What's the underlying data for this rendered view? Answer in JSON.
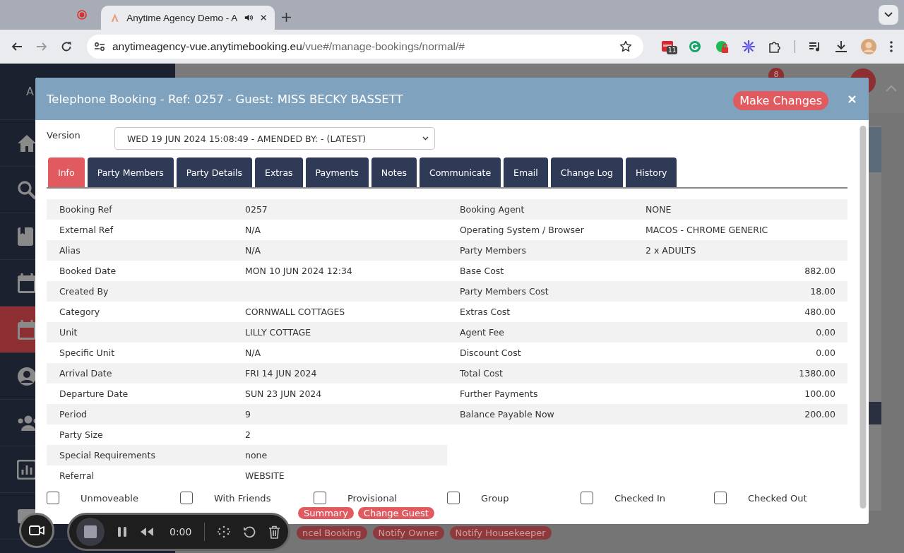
{
  "browser": {
    "tabs": [
      {
        "kind": "recording",
        "selected": false
      },
      {
        "kind": "page",
        "title": "Anytime Agency Demo - A",
        "selected": true
      }
    ],
    "address": {
      "host": "anytimeagency-vue.anytimebooking.eu",
      "path": "/vue#/manage-bookings/normal/#"
    },
    "extension_badge": "11"
  },
  "app": {
    "brand": "A",
    "sidebar": [
      {
        "kind": "home",
        "selected": false
      },
      {
        "kind": "search",
        "selected": false
      },
      {
        "kind": "book",
        "selected": false
      },
      {
        "kind": "calendar",
        "selected": false
      },
      {
        "kind": "calendar",
        "selected": true
      },
      {
        "kind": "user",
        "selected": false
      },
      {
        "kind": "users",
        "selected": false
      },
      {
        "kind": "chart",
        "selected": false
      },
      {
        "kind": "box",
        "selected": false
      }
    ],
    "notification_badge": "8",
    "page_actions": [
      "ncel Booking",
      "Notify Owner",
      "Notify Housekeeper"
    ]
  },
  "modal": {
    "title": "Telephone Booking - Ref: 0257 - Guest: MISS BECKY BASSETT",
    "make_changes": "Make Changes",
    "version": {
      "label": "Version",
      "value": "WED 19 JUN 2024 15:08:49 - AMENDED BY: - (LATEST)"
    },
    "tabs": [
      {
        "label": "Info",
        "selected": true
      },
      {
        "label": "Party Members",
        "selected": false
      },
      {
        "label": "Party Details",
        "selected": false
      },
      {
        "label": "Extras",
        "selected": false
      },
      {
        "label": "Payments",
        "selected": false
      },
      {
        "label": "Notes",
        "selected": false
      },
      {
        "label": "Communicate",
        "selected": false
      },
      {
        "label": "Email",
        "selected": false
      },
      {
        "label": "Change Log",
        "selected": false
      },
      {
        "label": "History",
        "selected": false
      }
    ],
    "details_left": [
      {
        "label": "Booking Ref",
        "value": "0257"
      },
      {
        "label": "External Ref",
        "value": "N/A"
      },
      {
        "label": "Alias",
        "value": "N/A"
      },
      {
        "label": "Booked Date",
        "value": "MON 10 JUN 2024 12:34"
      },
      {
        "label": "Created By"
      },
      {
        "label": "Category",
        "value": "CORNWALL COTTAGES"
      },
      {
        "label": "Unit",
        "value": "LILLY COTTAGE"
      },
      {
        "label": "Specific Unit",
        "value": "N/A"
      },
      {
        "label": "Arrival Date",
        "value": "FRI 14 JUN 2024"
      },
      {
        "label": "Departure Date",
        "value": "SUN 23 JUN 2024"
      },
      {
        "label": "Period",
        "value": "9"
      },
      {
        "label": "Party Size",
        "value": "2"
      },
      {
        "label": "Special Requirements",
        "value": "none"
      },
      {
        "label": "Referral",
        "value": "WEBSITE"
      }
    ],
    "details_right": [
      {
        "label": "Booking Agent",
        "value": "NONE",
        "kind": "text"
      },
      {
        "label": "Operating System / Browser",
        "value": "MACOS - CHROME GENERIC",
        "kind": "text"
      },
      {
        "label": "Party Members",
        "value": "2 x ADULTS",
        "kind": "text"
      },
      {
        "label": "Base Cost",
        "value": "882.00",
        "kind": "amount"
      },
      {
        "label": "Party Members Cost",
        "value": "18.00",
        "kind": "amount"
      },
      {
        "label": "Extras Cost",
        "value": "480.00",
        "kind": "amount"
      },
      {
        "label": "Agent Fee",
        "value": "0.00",
        "kind": "amount"
      },
      {
        "label": "Discount Cost",
        "value": "0.00",
        "kind": "amount"
      },
      {
        "label": "Total Cost",
        "value": "1380.00",
        "kind": "amount"
      },
      {
        "label": "Further Payments",
        "value": "100.00",
        "kind": "amount"
      },
      {
        "label": "Balance Payable Now",
        "value": "200.00",
        "kind": "amount"
      }
    ],
    "flags": [
      {
        "label": "Unmoveable",
        "checked": false
      },
      {
        "label": "With Friends",
        "checked": false
      },
      {
        "label": "Provisional",
        "checked": false
      },
      {
        "label": "Group",
        "checked": false
      },
      {
        "label": "Checked In",
        "checked": false
      },
      {
        "label": "Checked Out",
        "checked": false
      }
    ],
    "actions": [
      "Summary",
      "Change Guest"
    ]
  },
  "recorder": {
    "time": "0:00"
  }
}
